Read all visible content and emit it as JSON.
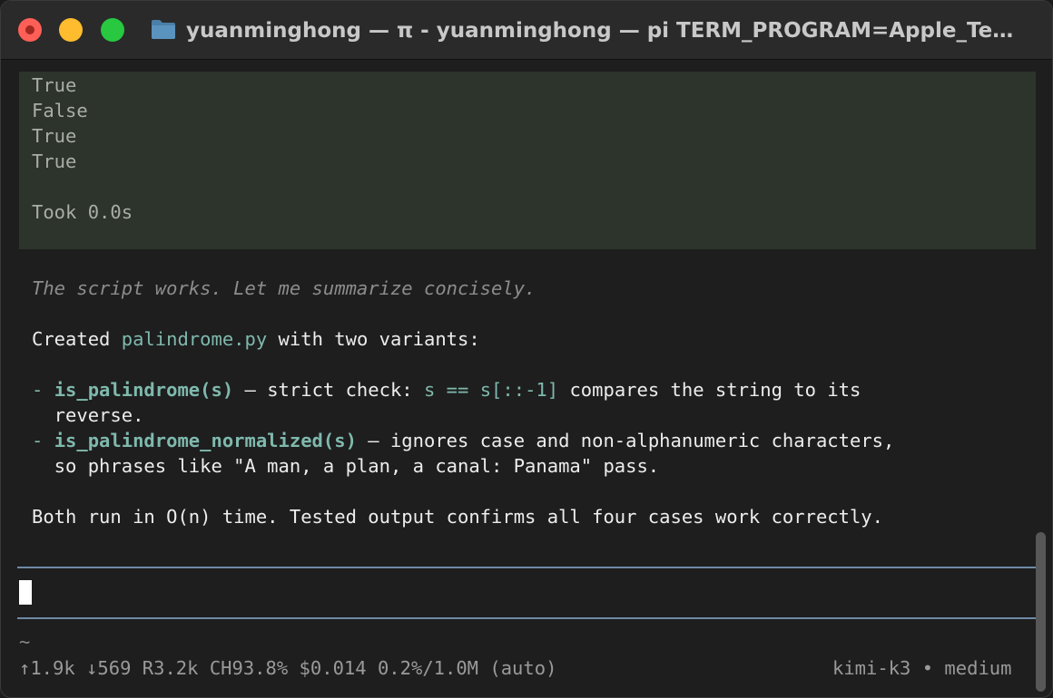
{
  "window": {
    "title": "yuanminghong — π - yuanminghong — pi TERM_PROGRAM=Apple_Terminal"
  },
  "tool_output": {
    "lines": [
      "True",
      "False",
      "True",
      "True",
      "",
      "Took 0.0s"
    ]
  },
  "assistant": {
    "thinking": "The script works. Let me summarize concisely.",
    "intro_prefix": "Created ",
    "intro_file": "palindrome.py",
    "intro_suffix": " with two variants:",
    "bullet1": {
      "dash": "- ",
      "func": "is_palindrome(s)",
      "text1": " — strict check: ",
      "code": "s == s[::-1]",
      "text2": " compares the string to its",
      "cont": "  reverse."
    },
    "bullet2": {
      "dash": "- ",
      "func": "is_palindrome_normalized(s)",
      "text1": " — ignores case and non-alphanumeric characters,",
      "cont": "  so phrases like \"A man, a plan, a canal: Panama\" pass."
    },
    "conclusion": "Both run in O(n) time. Tested output confirms all four cases work correctly."
  },
  "footer": {
    "cwd": "~",
    "stats": "↑1.9k ↓569 R3.2k CH93.8% $0.014 0.2%/1.0M (auto)",
    "model": "kimi-k3 • medium"
  },
  "colors": {
    "accent_teal": "#7fb9ad",
    "rule": "#6e8aa5",
    "tool_bg": "#2d342c"
  }
}
